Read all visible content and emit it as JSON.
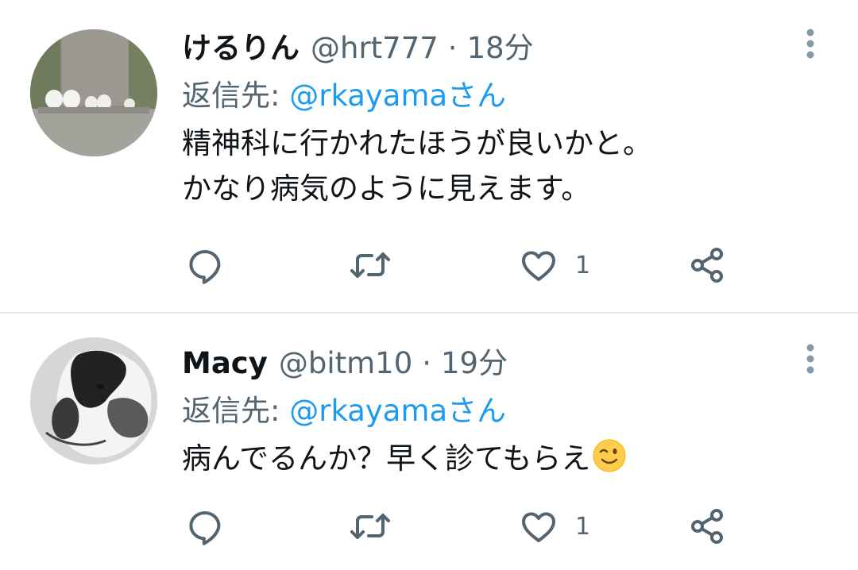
{
  "tweets": [
    {
      "name": "けるりん",
      "handle": "@hrt777",
      "separator": "·",
      "time": "18分",
      "reply_prefix": "返信先: ",
      "reply_mention": "@rkayamaさん",
      "lines": [
        "精神科に行かれたほうが良いかと。",
        "かなり病気のように見えます。"
      ],
      "like_count": "1"
    },
    {
      "name": "Macy",
      "handle": "@bitm10",
      "separator": "·",
      "time": "19分",
      "reply_prefix": "返信先: ",
      "reply_mention": "@rkayamaさん",
      "lines": [
        "病んでるんか？早く診てもらえ"
      ],
      "emoji": "winking-face",
      "like_count": "1"
    }
  ],
  "icons": [
    "more-vertical-icon",
    "reply-icon",
    "retweet-icon",
    "like-icon",
    "share-icon"
  ],
  "colors": {
    "link": "#1d9bf0",
    "secondary": "#536471",
    "primary": "#0f1419",
    "divider": "#e6ecf0"
  }
}
